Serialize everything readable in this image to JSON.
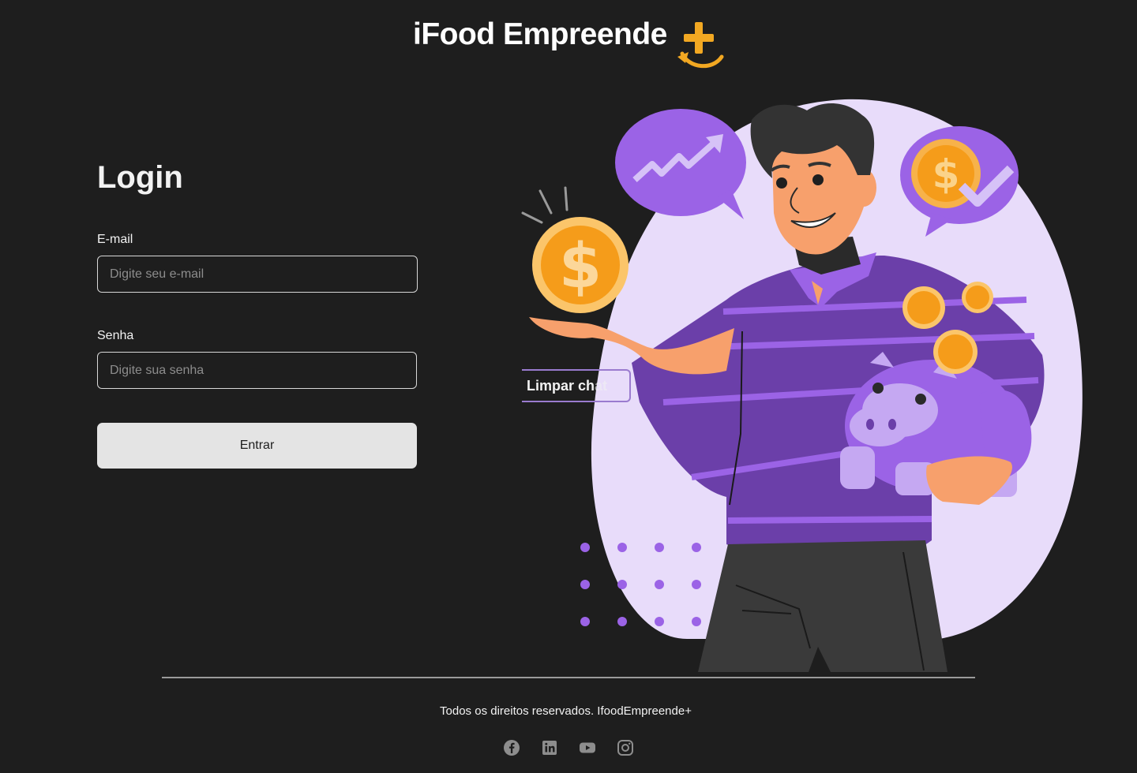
{
  "brand": {
    "name": "iFood Empreende"
  },
  "login": {
    "title": "Login",
    "email_label": "E-mail",
    "email_placeholder": "Digite seu e-mail",
    "email_value": "",
    "password_label": "Senha",
    "password_placeholder": "Digite sua senha",
    "password_value": "",
    "submit_label": "Entrar"
  },
  "overlay": {
    "clear_chat_label_visible": "Limpar ch",
    "clear_chat_label_faded": "at"
  },
  "footer": {
    "copyright": "Todos os direitos reservados. IfoodEmpreende+",
    "socials": [
      "facebook-icon",
      "linkedin-icon",
      "youtube-icon",
      "instagram-icon"
    ]
  },
  "colors": {
    "background": "#1e1e1e",
    "accent_purple": "#7d4ec9",
    "light_purple": "#e8dcfa",
    "coin_orange": "#f59c1a",
    "button_bg": "#e4e4e4"
  }
}
